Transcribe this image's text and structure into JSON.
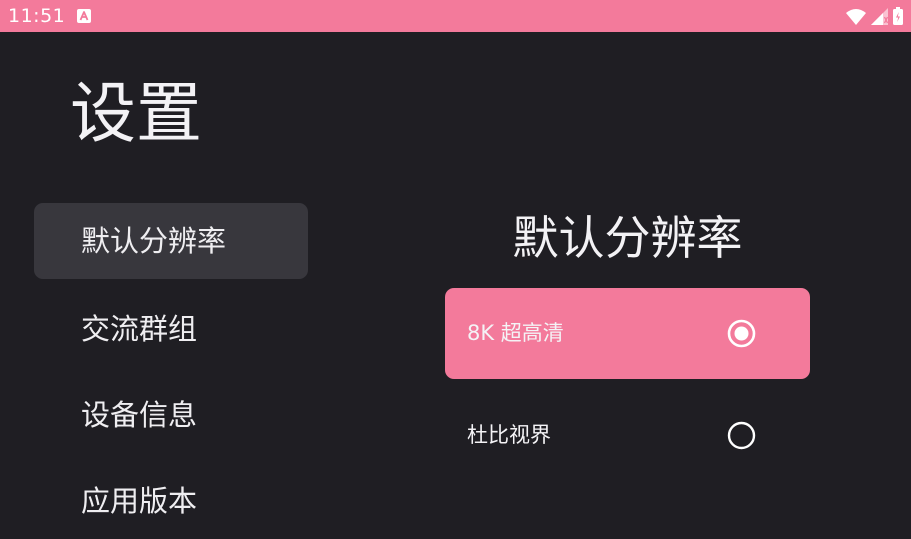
{
  "status_bar": {
    "time": "11:51",
    "notification_icon": "a-square-icon",
    "icons": [
      "wifi-icon",
      "signal-icon",
      "battery-icon"
    ],
    "background": "#f37a9b"
  },
  "page": {
    "title": "设置"
  },
  "sidebar": {
    "items": [
      {
        "label": "默认分辨率",
        "active": true
      },
      {
        "label": "交流群组",
        "active": false
      },
      {
        "label": "设备信息",
        "active": false
      },
      {
        "label": "应用版本",
        "active": false
      }
    ]
  },
  "content": {
    "section_title": "默认分辨率",
    "options": [
      {
        "label": "8K 超高清",
        "selected": true
      },
      {
        "label": "杜比视界",
        "selected": false
      }
    ]
  },
  "colors": {
    "accent": "#f37a9b",
    "background": "#1f1e23",
    "sidebar_active": "#38373d",
    "text": "#f1f0f3"
  }
}
